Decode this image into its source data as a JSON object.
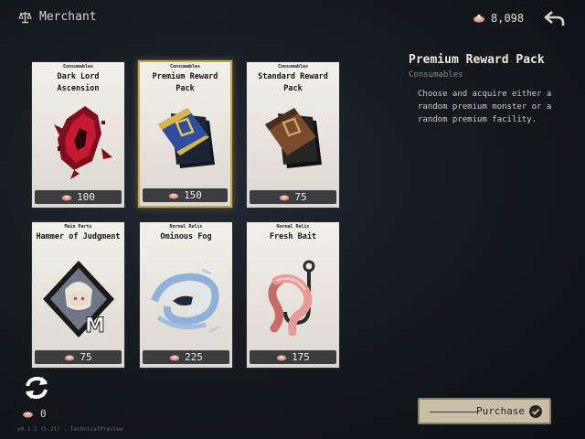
{
  "header": {
    "title": "Merchant",
    "currency_amount": "8,098"
  },
  "cards": [
    {
      "category": "Consumables",
      "name": "Dark Lord Ascension",
      "price": "100"
    },
    {
      "category": "Consumables",
      "name": "Premium Reward Pack",
      "price": "150"
    },
    {
      "category": "Consumables",
      "name": "Standard Reward Pack",
      "price": "75"
    },
    {
      "category": "Main Parts",
      "name": "Hammer of Judgment",
      "price": "75"
    },
    {
      "category": "Normal Relic",
      "name": "Ominous Fog",
      "price": "225"
    },
    {
      "category": "Normal Relic",
      "name": "Fresh Bait",
      "price": "175"
    }
  ],
  "detail": {
    "title": "Premium Reward Pack",
    "category": "Consumables",
    "description": "Choose and acquire either a random premium monster or a random premium facility."
  },
  "wallet": {
    "amount": "0"
  },
  "version": "v0.1.1 (b.21) - TechnicalPreview",
  "purchase_label": "Purchase",
  "colors": {
    "selected_border": "#c2a65a",
    "purchase_bg": "#c9bfa6"
  }
}
